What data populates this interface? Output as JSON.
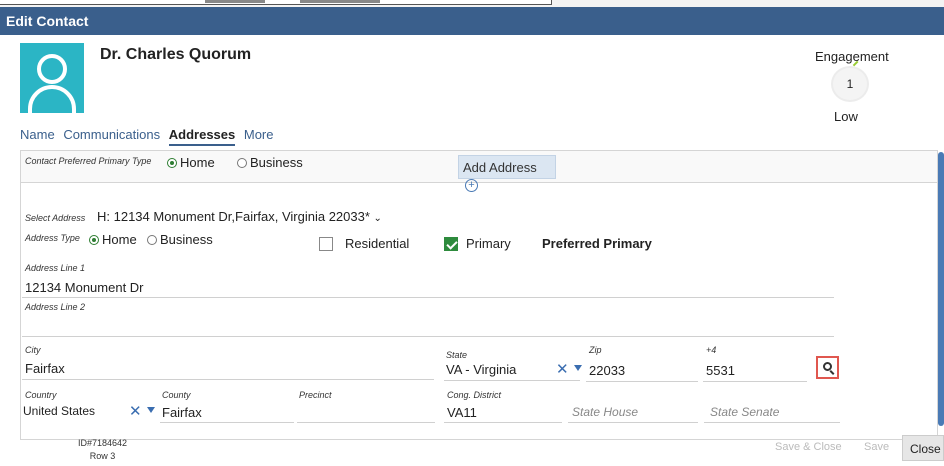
{
  "window": {
    "title": "Edit Contact"
  },
  "contact": {
    "name": "Dr. Charles Quorum"
  },
  "engagement": {
    "label": "Engagement",
    "value": "1",
    "level": "Low"
  },
  "tabs": [
    {
      "label": "Name"
    },
    {
      "label": "Communications"
    },
    {
      "label": "Addresses",
      "active": true
    },
    {
      "label": "More"
    }
  ],
  "preferred": {
    "label": "Contact Preferred Primary Type",
    "options": [
      "Home",
      "Business"
    ],
    "selected": "Home",
    "add_address_label": "Add Address"
  },
  "address": {
    "select_label": "Select Address",
    "selected_address": "H: 12134 Monument Dr,Fairfax, Virginia 22033*",
    "type_label": "Address Type",
    "type_options": [
      "Home",
      "Business"
    ],
    "type_selected": "Home",
    "residential_label": "Residential",
    "residential_checked": false,
    "primary_label": "Primary",
    "primary_checked": true,
    "preferred_primary_label": "Preferred Primary",
    "line1_label": "Address Line 1",
    "line1_value": "12134 Monument Dr",
    "line2_label": "Address Line 2",
    "line2_value": "",
    "city_label": "City",
    "city_value": "Fairfax",
    "state_label": "State",
    "state_value": "VA - Virginia",
    "zip_label": "Zip",
    "zip_value": "22033",
    "plus4_label": "+4",
    "plus4_value": "5531",
    "country_label": "Country",
    "country_value": "United States",
    "county_label": "County",
    "county_value": "Fairfax",
    "precinct_label": "Precinct",
    "precinct_value": "",
    "cong_district_label": "Cong. District",
    "cong_district_value": "VA11",
    "state_house_placeholder": "State House",
    "state_senate_placeholder": "State Senate"
  },
  "footer": {
    "id_text": "ID#7184642",
    "row_text": "Row 3",
    "save_close_label": "Save & Close",
    "save_label": "Save",
    "close_label": "Close"
  },
  "colors": {
    "titlebar": "#3a5f8c",
    "avatar": "#2bb5c5",
    "accent": "#2e8b3d",
    "lookup_border": "#e0574f"
  }
}
